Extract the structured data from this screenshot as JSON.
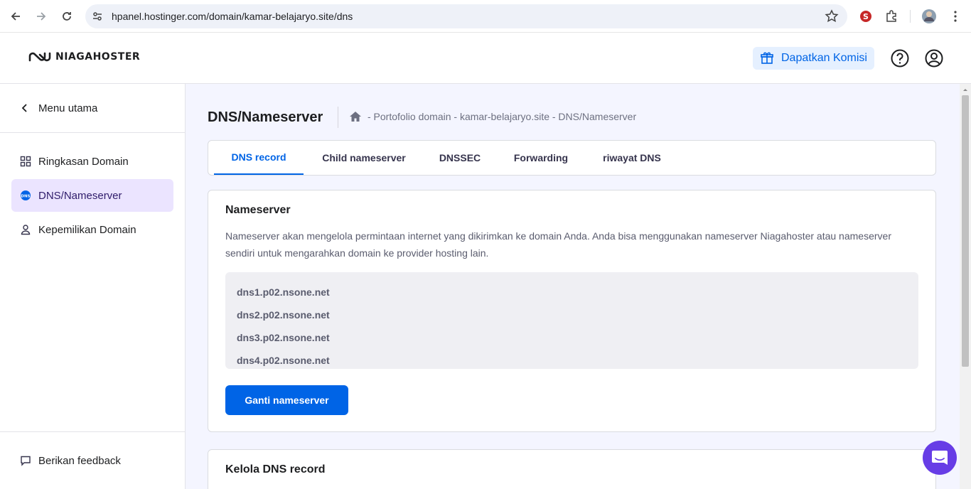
{
  "browser": {
    "url": "hpanel.hostinger.com/domain/kamar-belajaryo.site/dns"
  },
  "header": {
    "logo_text": "NIAGAHOSTER",
    "komisi_label": "Dapatkan Komisi"
  },
  "sidebar": {
    "back_label": "Menu utama",
    "items": [
      {
        "label": "Ringkasan Domain",
        "icon": "grid-icon",
        "active": false
      },
      {
        "label": "DNS/Nameserver",
        "icon": "dns-icon",
        "active": true
      },
      {
        "label": "Kepemilikan Domain",
        "icon": "person-icon",
        "active": false
      }
    ],
    "feedback_label": "Berikan feedback"
  },
  "main": {
    "title": "DNS/Nameserver",
    "breadcrumb": "- Portofolio domain - kamar-belajaryo.site - DNS/Nameserver",
    "tabs": [
      {
        "label": "DNS record",
        "active": true
      },
      {
        "label": "Child nameserver",
        "active": false
      },
      {
        "label": "DNSSEC",
        "active": false
      },
      {
        "label": "Forwarding",
        "active": false
      },
      {
        "label": "riwayat DNS",
        "active": false
      }
    ],
    "nameserver_card": {
      "title": "Nameserver",
      "description": "Nameserver akan mengelola permintaan internet yang dikirimkan ke domain Anda. Anda bisa menggunakan nameserver Niagahoster atau nameserver sendiri untuk mengarahkan domain ke provider hosting lain.",
      "nameservers": [
        "dns1.p02.nsone.net",
        "dns2.p02.nsone.net",
        "dns3.p02.nsone.net",
        "dns4.p02.nsone.net"
      ],
      "button_label": "Ganti nameserver"
    },
    "dns_card": {
      "title": "Kelola DNS record"
    }
  },
  "colors": {
    "accent": "#0064e6",
    "active_bg": "#ebe4ff",
    "chat": "#673de6"
  }
}
